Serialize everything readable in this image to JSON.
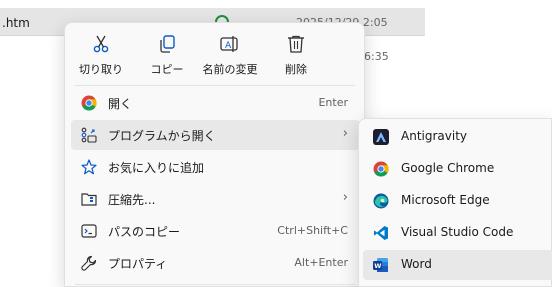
{
  "background": {
    "filename": ".htm",
    "date": "2025/12/29 2:05",
    "time2": "6:35"
  },
  "menu": {
    "actions": [
      {
        "label": "切り取り",
        "icon": "cut-icon"
      },
      {
        "label": "コピー",
        "icon": "copy-icon"
      },
      {
        "label": "名前の変更",
        "icon": "rename-icon"
      },
      {
        "label": "削除",
        "icon": "delete-icon"
      }
    ],
    "items": [
      {
        "label": "開く",
        "shortcut": "Enter",
        "icon": "chrome-icon"
      },
      {
        "label": "プログラムから開く",
        "icon": "open-with-icon",
        "submenu": true
      },
      {
        "label": "お気に入りに追加",
        "icon": "star-icon"
      },
      {
        "label": "圧縮先...",
        "icon": "compress-icon",
        "submenu": true
      },
      {
        "label": "パスのコピー",
        "shortcut": "Ctrl+Shift+C",
        "icon": "copy-path-icon"
      },
      {
        "label": "プロパティ",
        "shortcut": "Alt+Enter",
        "icon": "wrench-icon"
      }
    ]
  },
  "submenu": {
    "items": [
      {
        "label": "Antigravity",
        "icon": "antigravity-icon"
      },
      {
        "label": "Google Chrome",
        "icon": "chrome-icon"
      },
      {
        "label": "Microsoft Edge",
        "icon": "edge-icon"
      },
      {
        "label": "Visual Studio Code",
        "icon": "vscode-icon"
      },
      {
        "label": "Word",
        "icon": "word-icon"
      }
    ]
  },
  "colors": {
    "menu_bg": "#f9f9f9",
    "hover_bg": "#e8e8e8",
    "accent_blue": "#0a5bc4",
    "word_blue": "#185abd",
    "vscode_blue": "#007acc"
  }
}
